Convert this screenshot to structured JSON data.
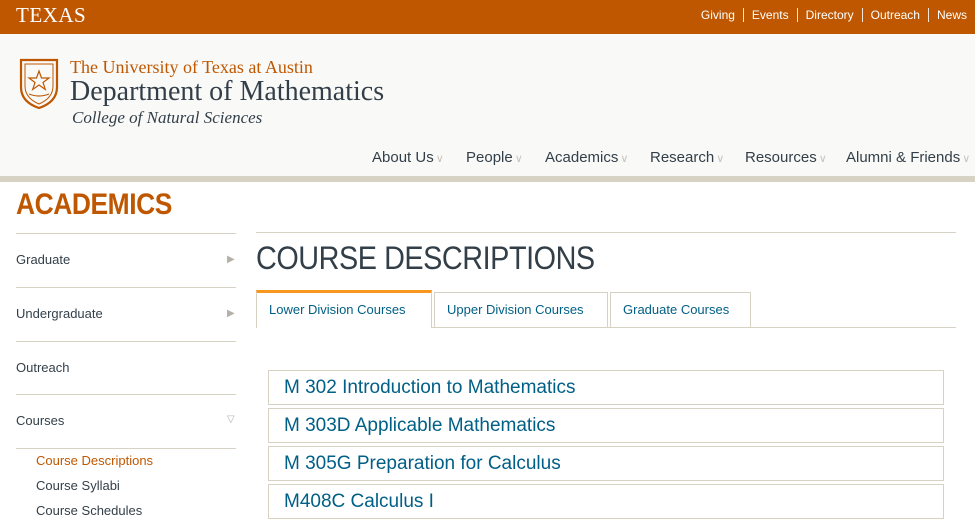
{
  "topbar": {
    "wordmark": "TEXAS",
    "links": [
      "Giving",
      "Events",
      "Directory",
      "Outreach",
      "News"
    ]
  },
  "header": {
    "university": "The University of Texas at Austin",
    "department": "Department of Mathematics",
    "college": "College of Natural Sciences",
    "nav": [
      {
        "label": "About Us"
      },
      {
        "label": "People"
      },
      {
        "label": "Academics"
      },
      {
        "label": "Research"
      },
      {
        "label": "Resources"
      },
      {
        "label": "Alumni & Friends"
      }
    ]
  },
  "sidebar": {
    "title": "ACADEMICS",
    "items": [
      {
        "label": "Graduate",
        "expandable": true
      },
      {
        "label": "Undergraduate",
        "expandable": true
      },
      {
        "label": "Outreach",
        "expandable": false
      },
      {
        "label": "Courses",
        "expandable": true,
        "expanded": true
      }
    ],
    "subitems": [
      {
        "label": "Course Descriptions",
        "active": true
      },
      {
        "label": "Course Syllabi",
        "active": false
      },
      {
        "label": "Course Schedules",
        "active": false
      }
    ]
  },
  "main": {
    "title": "COURSE DESCRIPTIONS",
    "tabs": [
      {
        "label": "Lower Division Courses",
        "active": true
      },
      {
        "label": "Upper Division Courses",
        "active": false
      },
      {
        "label": "Graduate Courses",
        "active": false
      }
    ],
    "courses": [
      "M 302 Introduction to Mathematics",
      "M 303D Applicable Mathematics",
      "M 305G Preparation for Calculus",
      "M408C Calculus I"
    ]
  },
  "colors": {
    "brand_orange": "#bf5700",
    "link_blue": "#005f86",
    "text_dark": "#333f48",
    "tab_accent": "#f8971f",
    "rule": "#d6d2c4"
  },
  "icons": {
    "seal": "ut-seal-icon",
    "nav_chevron": "chevron-down-icon",
    "side_arrow": "triangle-right-icon",
    "side_arrow_open": "triangle-down-icon"
  }
}
